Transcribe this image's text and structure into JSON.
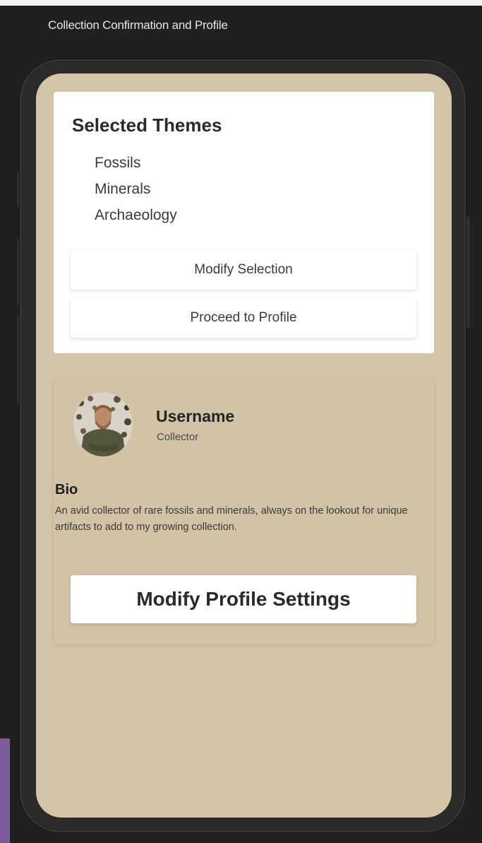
{
  "window": {
    "title": "Collection Confirmation and Profile"
  },
  "themes": {
    "title": "Selected Themes",
    "items": [
      "Fossils",
      "Minerals",
      "Archaeology"
    ],
    "modify_label": "Modify Selection",
    "proceed_label": "Proceed to Profile"
  },
  "profile": {
    "username": "Username",
    "role": "Collector",
    "bio_heading": "Bio",
    "bio_text": "An avid collector of rare fossils and minerals, always on the lookout for unique artifacts to add to my growing collection.",
    "settings_label": "Modify Profile Settings",
    "avatar_icon": "user-avatar-photo"
  },
  "colors": {
    "screen_background": "#d4c4a8",
    "card_background": "#ffffff",
    "frame": "#2a2a2a",
    "accent_purple": "#7d5b9b"
  }
}
